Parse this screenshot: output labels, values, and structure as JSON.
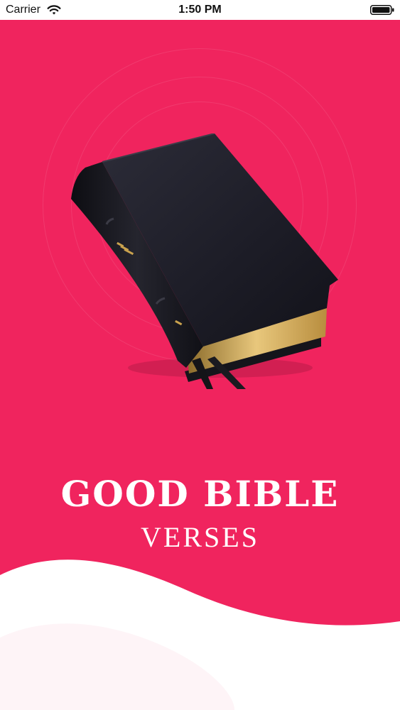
{
  "status_bar": {
    "carrier": "Carrier",
    "time": "1:50 PM"
  },
  "splash": {
    "title_line1": "GOOD BIBLE",
    "title_line2": "VERSES"
  },
  "colors": {
    "brand_pink": "#f0245e",
    "text_white": "#ffffff",
    "wave_white": "#ffffff"
  },
  "icons": [
    "wifi-icon",
    "battery-icon",
    "bible-book-illustration"
  ]
}
